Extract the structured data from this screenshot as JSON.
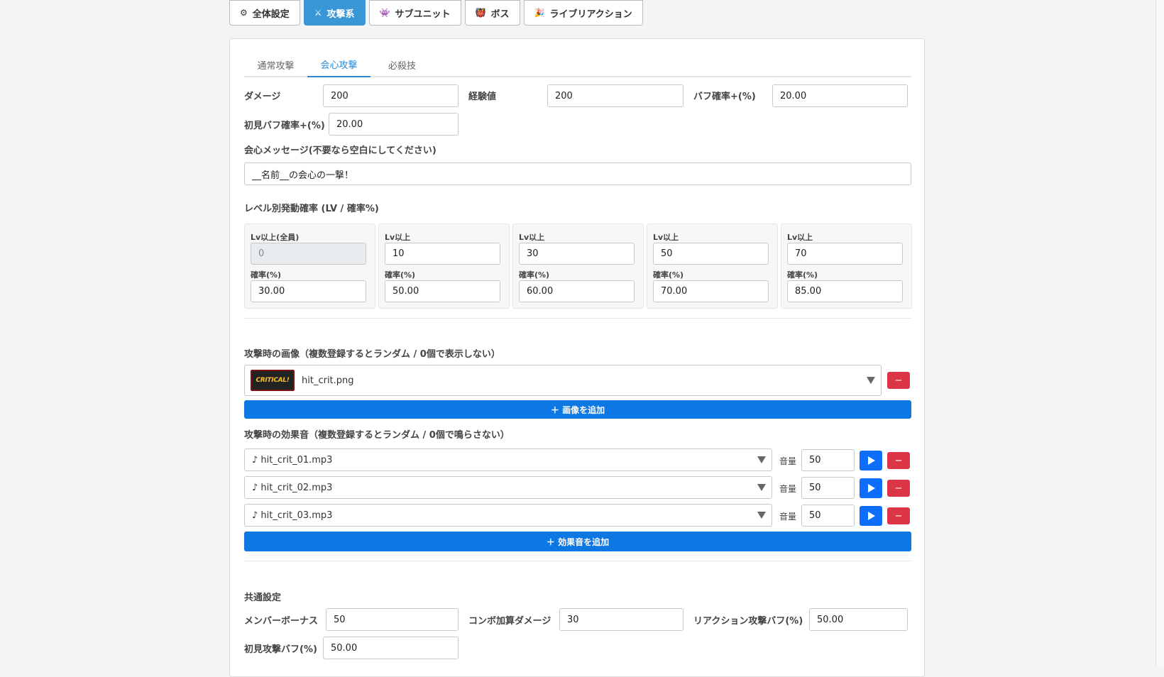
{
  "top_tabs": [
    {
      "icon": "⚙",
      "label": "全体設定"
    },
    {
      "icon": "⚔",
      "label": "攻撃系"
    },
    {
      "icon": "👾",
      "label": "サブユニット"
    },
    {
      "icon": "👹",
      "label": "ボス"
    },
    {
      "icon": "🎉",
      "label": "ライブリアクション"
    }
  ],
  "active_top_tab": "攻撃系",
  "sub_tabs": [
    {
      "label": "通常攻撃"
    },
    {
      "label": "会心攻撃"
    },
    {
      "label": "必殺技"
    }
  ],
  "active_sub_tab": "会心攻撃",
  "critical": {
    "damage_label": "ダメージ",
    "damage_value": "200",
    "exp_label": "経験値",
    "exp_value": "200",
    "buff_rate_label": "バフ確率+(%)",
    "buff_rate_value": "20.00",
    "first_buff_label": "初見バフ確率+(%)",
    "first_buff_value": "20.00",
    "message_label": "会心メッセージ(不要なら空白にしてください)",
    "message_value": "__名前__の会心の一撃！"
  },
  "level_rates": {
    "title": "レベル別発動確率 (LV / 確率%)",
    "rate_label": "確率(%)",
    "items": [
      {
        "lv_label": "Lv以上(全員)",
        "lv": "0",
        "rate": "30.00"
      },
      {
        "lv_label": "Lv以上",
        "lv": "10",
        "rate": "50.00"
      },
      {
        "lv_label": "Lv以上",
        "lv": "30",
        "rate": "60.00"
      },
      {
        "lv_label": "Lv以上",
        "lv": "50",
        "rate": "70.00"
      },
      {
        "lv_label": "Lv以上",
        "lv": "70",
        "rate": "85.00"
      }
    ]
  },
  "images": {
    "title": "攻撃時の画像（複数登録するとランダム / 0個で表示しない）",
    "thumb_text": "CRITICAL!",
    "file": "hit_crit.png",
    "remove_label": "−",
    "add_label": "＋ 画像を追加"
  },
  "sounds": {
    "title": "攻撃時の効果音（複数登録するとランダム / 0個で鳴らさない）",
    "volume_label": "音量",
    "remove_label": "−",
    "items": [
      {
        "file": "♪ hit_crit_01.mp3",
        "volume": "50"
      },
      {
        "file": "♪ hit_crit_02.mp3",
        "volume": "50"
      },
      {
        "file": "♪ hit_crit_03.mp3",
        "volume": "50"
      }
    ],
    "add_label": "＋ 効果音を追加"
  },
  "common": {
    "title": "共通設定",
    "member_bonus_label": "メンバーボーナス",
    "member_bonus_value": "50",
    "combo_label": "コンボ加算ダメージ",
    "combo_value": "30",
    "reaction_buff_label": "リアクション攻撃バフ(%)",
    "reaction_buff_value": "50.00",
    "first_attack_label": "初見攻撃バフ(%)",
    "first_attack_value": "50.00"
  },
  "colors": {
    "accent": "#3a97d6",
    "primary": "#0d77e3",
    "danger": "#dc3545"
  }
}
